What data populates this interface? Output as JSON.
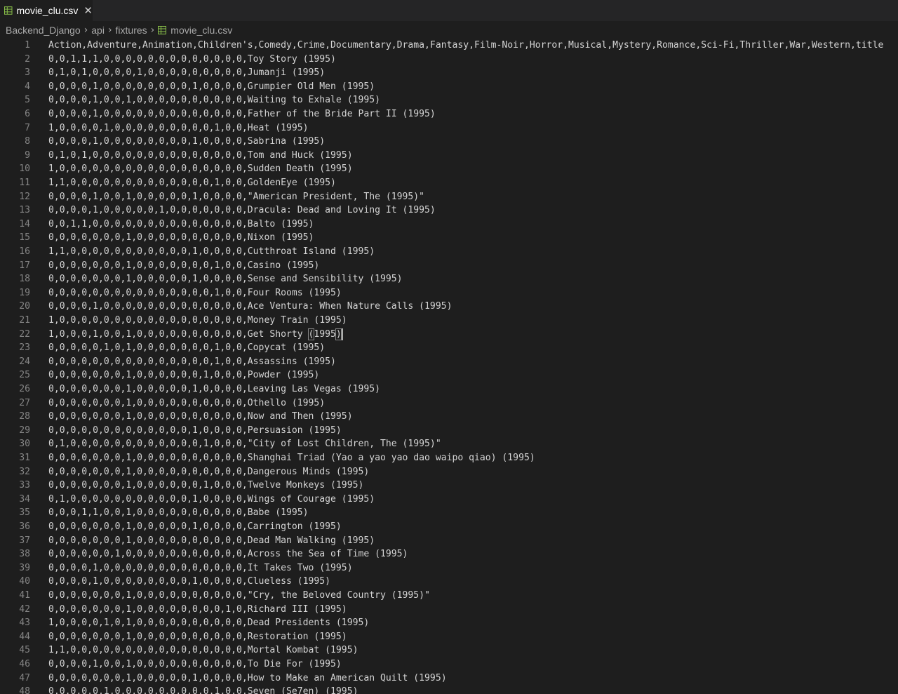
{
  "tab": {
    "label": "movie_clu.csv",
    "icon": "csv-file-icon",
    "close_glyph": "✕",
    "icon_color": "#8bc34a"
  },
  "breadcrumb": {
    "items": [
      "Backend_Django",
      "api",
      "fixtures"
    ],
    "file": "movie_clu.csv",
    "separator": "›"
  },
  "editor": {
    "first_line_number": 1,
    "lines": [
      "Action,Adventure,Animation,Children's,Comedy,Crime,Documentary,Drama,Fantasy,Film-Noir,Horror,Musical,Mystery,Romance,Sci-Fi,Thriller,War,Western,title",
      "0,0,1,1,1,0,0,0,0,0,0,0,0,0,0,0,0,0,Toy Story (1995)",
      "0,1,0,1,0,0,0,0,1,0,0,0,0,0,0,0,0,0,Jumanji (1995)",
      "0,0,0,0,1,0,0,0,0,0,0,0,0,1,0,0,0,0,Grumpier Old Men (1995)",
      "0,0,0,0,1,0,0,1,0,0,0,0,0,0,0,0,0,0,Waiting to Exhale (1995)",
      "0,0,0,0,1,0,0,0,0,0,0,0,0,0,0,0,0,0,Father of the Bride Part II (1995)",
      "1,0,0,0,0,1,0,0,0,0,0,0,0,0,0,1,0,0,Heat (1995)",
      "0,0,0,0,1,0,0,0,0,0,0,0,0,1,0,0,0,0,Sabrina (1995)",
      "0,1,0,1,0,0,0,0,0,0,0,0,0,0,0,0,0,0,Tom and Huck (1995)",
      "1,0,0,0,0,0,0,0,0,0,0,0,0,0,0,0,0,0,Sudden Death (1995)",
      "1,1,0,0,0,0,0,0,0,0,0,0,0,0,0,1,0,0,GoldenEye (1995)",
      "0,0,0,0,1,0,0,1,0,0,0,0,0,1,0,0,0,0,\"American President, The (1995)\"",
      "0,0,0,0,1,0,0,0,0,0,1,0,0,0,0,0,0,0,Dracula: Dead and Loving It (1995)",
      "0,0,1,1,0,0,0,0,0,0,0,0,0,0,0,0,0,0,Balto (1995)",
      "0,0,0,0,0,0,0,1,0,0,0,0,0,0,0,0,0,0,Nixon (1995)",
      "1,1,0,0,0,0,0,0,0,0,0,0,0,1,0,0,0,0,Cutthroat Island (1995)",
      "0,0,0,0,0,0,0,1,0,0,0,0,0,0,0,1,0,0,Casino (1995)",
      "0,0,0,0,0,0,0,1,0,0,0,0,0,1,0,0,0,0,Sense and Sensibility (1995)",
      "0,0,0,0,0,0,0,0,0,0,0,0,0,0,0,1,0,0,Four Rooms (1995)",
      "0,0,0,0,1,0,0,0,0,0,0,0,0,0,0,0,0,0,Ace Ventura: When Nature Calls (1995)",
      "1,0,0,0,0,0,0,0,0,0,0,0,0,0,0,0,0,0,Money Train (1995)",
      "1,0,0,0,1,0,0,1,0,0,0,0,0,0,0,0,0,0,Get Shorty (1995)",
      "0,0,0,0,0,1,0,1,0,0,0,0,0,0,0,1,0,0,Copycat (1995)",
      "0,0,0,0,0,0,0,0,0,0,0,0,0,0,0,1,0,0,Assassins (1995)",
      "0,0,0,0,0,0,0,1,0,0,0,0,0,0,1,0,0,0,Powder (1995)",
      "0,0,0,0,0,0,0,1,0,0,0,0,0,1,0,0,0,0,Leaving Las Vegas (1995)",
      "0,0,0,0,0,0,0,1,0,0,0,0,0,0,0,0,0,0,Othello (1995)",
      "0,0,0,0,0,0,0,1,0,0,0,0,0,0,0,0,0,0,Now and Then (1995)",
      "0,0,0,0,0,0,0,0,0,0,0,0,0,1,0,0,0,0,Persuasion (1995)",
      "0,1,0,0,0,0,0,0,0,0,0,0,0,0,1,0,0,0,\"City of Lost Children, The (1995)\"",
      "0,0,0,0,0,0,0,1,0,0,0,0,0,0,0,0,0,0,Shanghai Triad (Yao a yao yao dao waipo qiao) (1995)",
      "0,0,0,0,0,0,0,1,0,0,0,0,0,0,0,0,0,0,Dangerous Minds (1995)",
      "0,0,0,0,0,0,0,1,0,0,0,0,0,0,1,0,0,0,Twelve Monkeys (1995)",
      "0,1,0,0,0,0,0,0,0,0,0,0,0,1,0,0,0,0,Wings of Courage (1995)",
      "0,0,0,1,1,0,0,1,0,0,0,0,0,0,0,0,0,0,Babe (1995)",
      "0,0,0,0,0,0,0,1,0,0,0,0,0,1,0,0,0,0,Carrington (1995)",
      "0,0,0,0,0,0,0,1,0,0,0,0,0,0,0,0,0,0,Dead Man Walking (1995)",
      "0,0,0,0,0,0,1,0,0,0,0,0,0,0,0,0,0,0,Across the Sea of Time (1995)",
      "0,0,0,0,1,0,0,0,0,0,0,0,0,0,0,0,0,0,It Takes Two (1995)",
      "0,0,0,0,1,0,0,0,0,0,0,0,0,1,0,0,0,0,Clueless (1995)",
      "0,0,0,0,0,0,0,1,0,0,0,0,0,0,0,0,0,0,\"Cry, the Beloved Country (1995)\"",
      "0,0,0,0,0,0,0,1,0,0,0,0,0,0,0,0,1,0,Richard III (1995)",
      "1,0,0,0,0,1,0,1,0,0,0,0,0,0,0,0,0,0,Dead Presidents (1995)",
      "0,0,0,0,0,0,0,1,0,0,0,0,0,0,0,0,0,0,Restoration (1995)",
      "1,1,0,0,0,0,0,0,0,0,0,0,0,0,0,0,0,0,Mortal Kombat (1995)",
      "0,0,0,0,1,0,0,1,0,0,0,0,0,0,0,0,0,0,To Die For (1995)",
      "0,0,0,0,0,0,0,1,0,0,0,0,0,1,0,0,0,0,How to Make an American Quilt (1995)",
      "0,0,0,0,0,1,0,0,0,0,0,0,0,0,0,1,0,0,Seven (Se7en) (1995)"
    ],
    "cursor_line": 22
  }
}
